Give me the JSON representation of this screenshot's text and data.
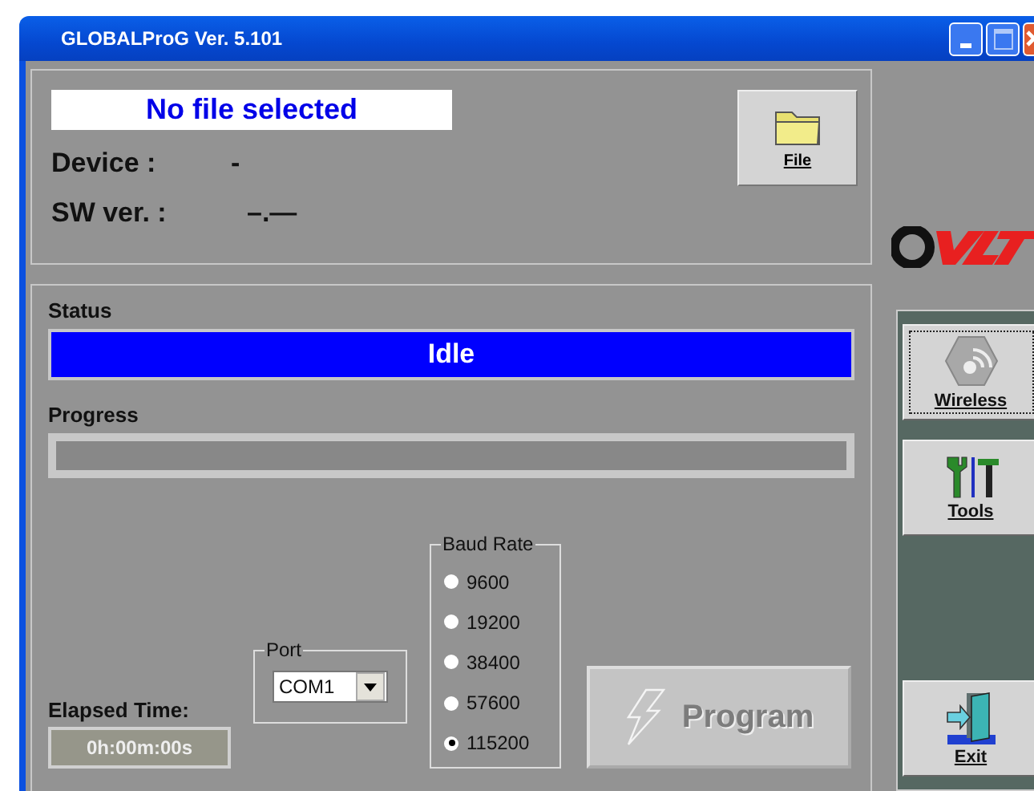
{
  "window": {
    "title": "GLOBALProG Ver. 5.101"
  },
  "file_info": {
    "file_name": "No file selected",
    "device_label": "Device :",
    "device_value": "-",
    "sw_label": "SW ver. :",
    "sw_value": "–.—",
    "file_button": "File"
  },
  "status": {
    "label": "Status",
    "value": "Idle"
  },
  "progress": {
    "label": "Progress",
    "level": 0
  },
  "elapsed": {
    "label": "Elapsed Time:",
    "value": "0h:00m:00s"
  },
  "port": {
    "label": "Port",
    "value": "COM1"
  },
  "baud_rate": {
    "label": "Baud Rate",
    "options": [
      {
        "label": "9600",
        "selected": false
      },
      {
        "label": "19200",
        "selected": false
      },
      {
        "label": "38400",
        "selected": false
      },
      {
        "label": "57600",
        "selected": false
      },
      {
        "label": "115200",
        "selected": true
      }
    ]
  },
  "program_button": {
    "label": "Program",
    "disabled": true
  },
  "nav": [
    {
      "kind": "wireless",
      "label": "Wireless",
      "focused": true
    },
    {
      "kind": "tools",
      "label": "Tools",
      "focused": false
    },
    {
      "kind": "exit",
      "label": "Exit",
      "focused": false
    }
  ]
}
